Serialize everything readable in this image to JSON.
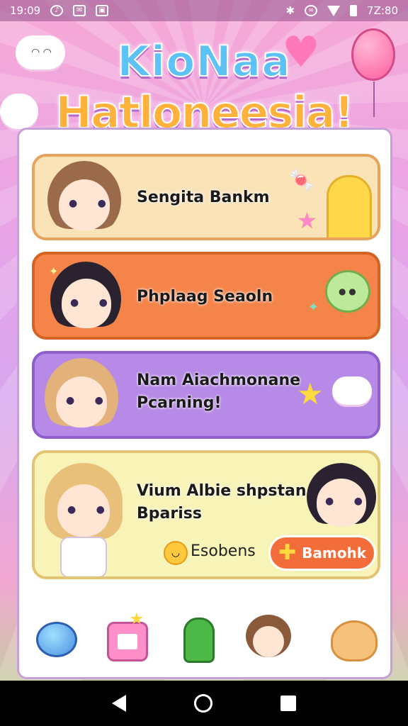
{
  "status_bar": {
    "time": "19:09",
    "clock_right": "7Z:80"
  },
  "title": {
    "line1": "KioNaa",
    "line2": "Hatloneesia!"
  },
  "title_colors": [
    "#ff5f8a",
    "#38c4f5",
    "#ffb23b",
    "#7ed957",
    "#b66cff",
    "#ff6f6f"
  ],
  "menu": [
    {
      "label": "Sengita Bankm",
      "color": "#fbe3b8"
    },
    {
      "label": "Phplaag Seaoln",
      "color": "#f5844a"
    },
    {
      "label_line1": "Nam Aiachmonane",
      "label_line2": "Pcarning!",
      "color": "#b68ae6"
    },
    {
      "label_line1": "Vium Albie shpstan",
      "label_line2": "Bpariss",
      "coin_label": "Esobens",
      "button_label": "Bamohk",
      "color": "#f8f3b7"
    }
  ],
  "bottom_icons": [
    "blue-creature-icon",
    "calendar-icon",
    "cactus-icon",
    "girl-avatar-icon",
    "cat-icon"
  ],
  "nav": {
    "back": "back-icon",
    "home": "home-icon",
    "recents": "recents-icon"
  }
}
